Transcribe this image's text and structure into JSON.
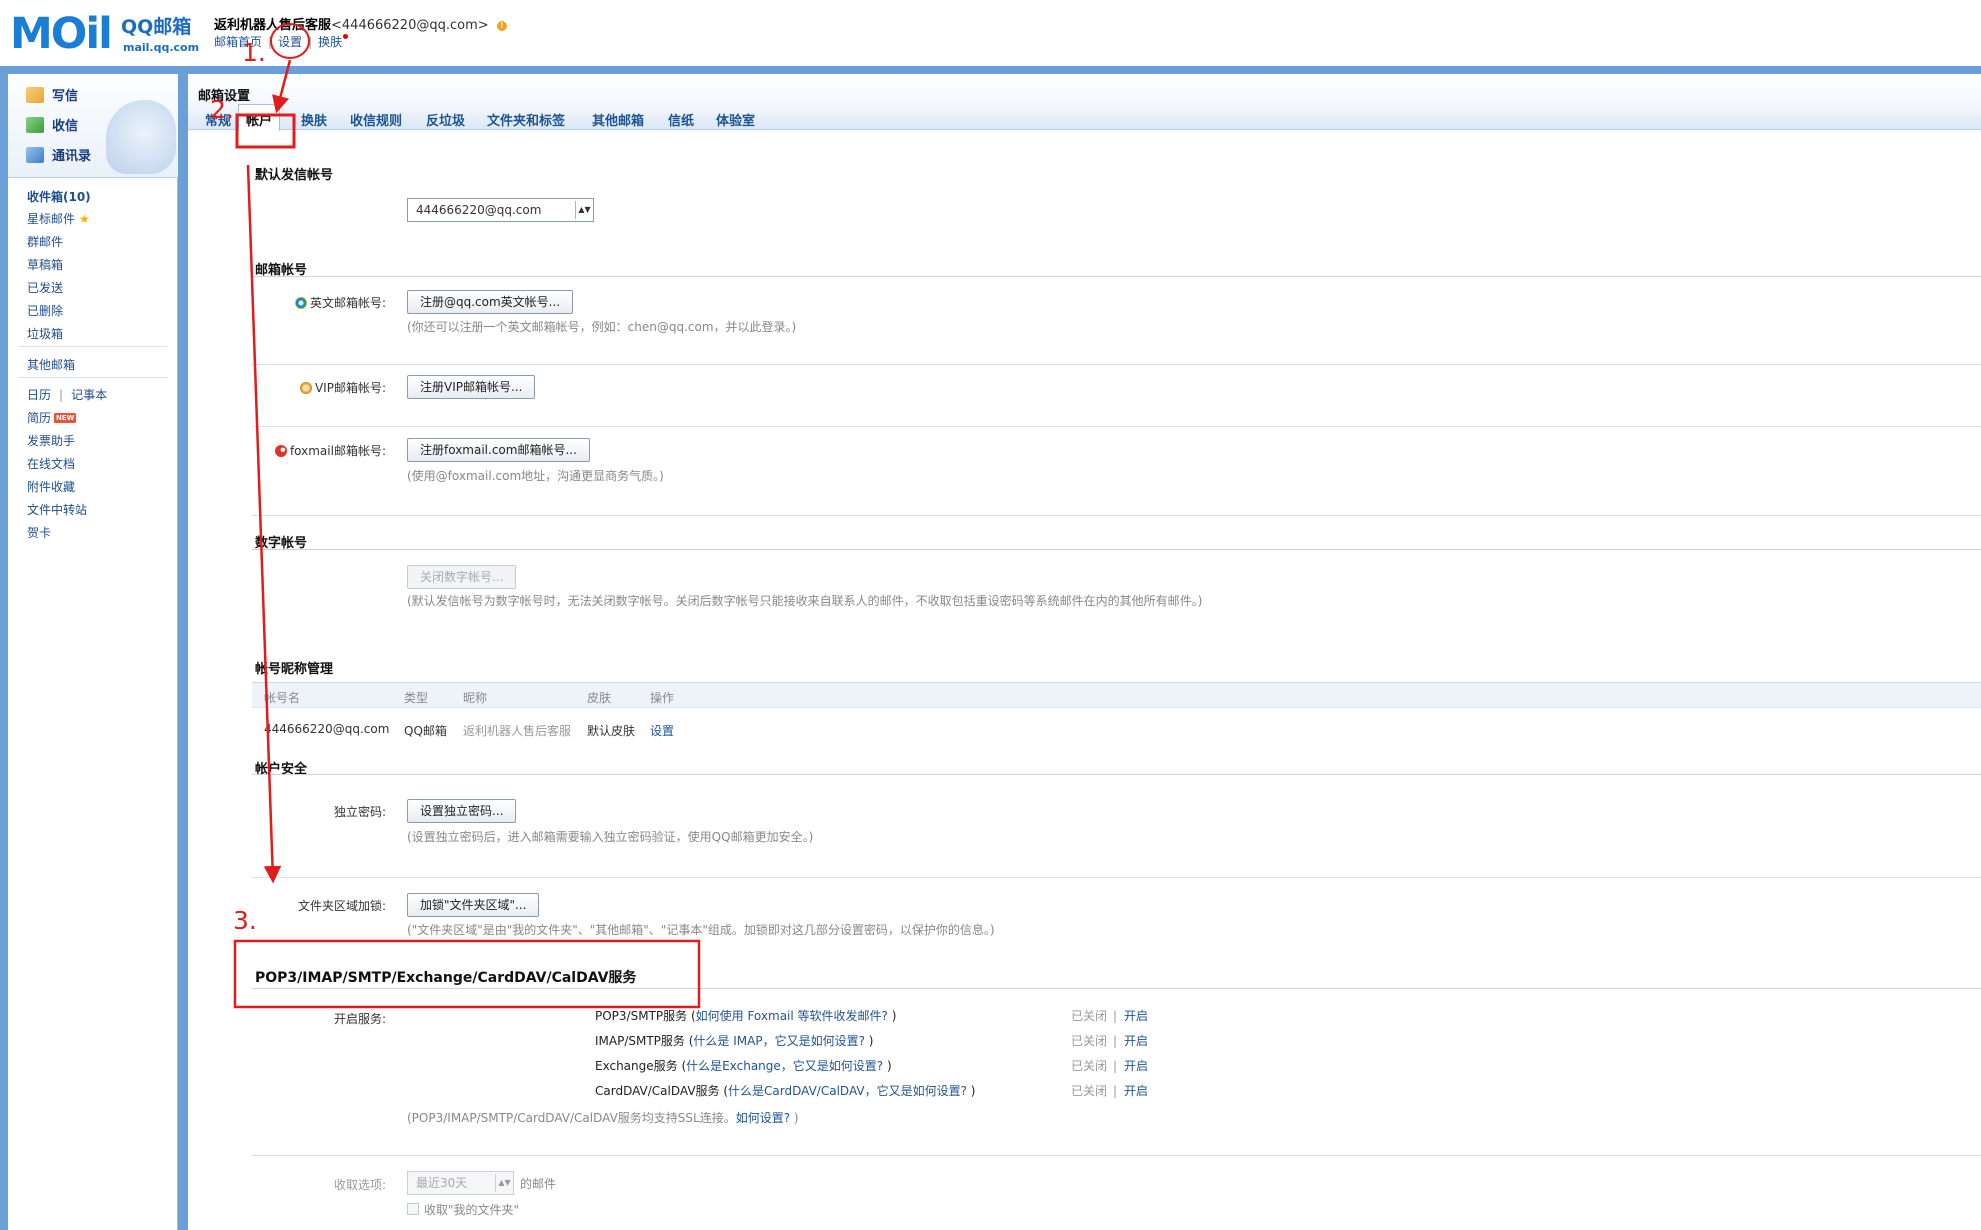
{
  "header": {
    "logo_mail": "MOil",
    "logo_qq": "QQ邮箱",
    "logo_url": "mail.qq.com",
    "user_name": "返利机器人售后客服",
    "user_email": "<444666220@qq.com>",
    "warn_icon": "!",
    "links": [
      "邮箱首页",
      "设置",
      "换肤"
    ],
    "link_sep": "|"
  },
  "sidebar": {
    "actions": [
      {
        "label": "写信",
        "icon": "compose-icon",
        "color": "#e9a23b"
      },
      {
        "label": "收信",
        "icon": "inbox-icon",
        "color": "#3a9d3a"
      },
      {
        "label": "通讯录",
        "icon": "contacts-icon",
        "color": "#3b7dc4"
      }
    ],
    "folders": [
      {
        "label": "收件箱(10)",
        "bold": true
      },
      {
        "label": "星标邮件",
        "star": "★"
      },
      {
        "label": "群邮件"
      },
      {
        "label": "草稿箱"
      },
      {
        "label": "已发送"
      },
      {
        "label": "已删除"
      },
      {
        "label": "垃圾箱"
      }
    ],
    "other_mail": "其他邮箱",
    "tools": {
      "calendar": "日历",
      "sep": "|",
      "notebook": "记事本",
      "resume": "简历",
      "new_badge": "NEW",
      "invoice": "发票助手",
      "docs": "在线文档",
      "attachments": "附件收藏",
      "transfer": "文件中转站",
      "cards": "贺卡"
    }
  },
  "main": {
    "title": "邮箱设置",
    "tabs": [
      "常规",
      "帐户",
      "换肤",
      "收信规则",
      "反垃圾",
      "文件夹和标签",
      "其他邮箱",
      "信纸",
      "体验室"
    ],
    "active_tab": 1,
    "default_sender": {
      "title": "默认发信帐号",
      "value": "444666220@qq.com",
      "arrow": "▲▼"
    },
    "mail_accounts": {
      "title": "邮箱帐号",
      "english_label": "英文邮箱帐号:",
      "english_button": "注册@qq.com英文帐号...",
      "english_hint": "(你还可以注册一个英文邮箱帐号，例如：chen@qq.com，并以此登录。)",
      "vip_label": "VIP邮箱帐号:",
      "vip_button": "注册VIP邮箱帐号...",
      "foxmail_label": "foxmail邮箱帐号:",
      "foxmail_button": "注册foxmail.com邮箱帐号...",
      "foxmail_hint": "(使用@foxmail.com地址，沟通更显商务气质。)"
    },
    "digital": {
      "title": "数字帐号",
      "button": "关闭数字帐号...",
      "hint": "(默认发信帐号为数字帐号时，无法关闭数字帐号。关闭后数字帐号只能接收来自联系人的邮件，不收取包括重设密码等系统邮件在内的其他所有邮件。)"
    },
    "nickname": {
      "title": "帐号昵称管理",
      "headers": [
        "帐号名",
        "类型",
        "昵称",
        "皮肤",
        "操作"
      ],
      "row": [
        "444666220@qq.com",
        "QQ邮箱",
        "返利机器人售后客服",
        "默认皮肤",
        "设置"
      ]
    },
    "security": {
      "title": "帐户安全",
      "pwd_label": "独立密码:",
      "pwd_button": "设置独立密码...",
      "pwd_hint": "(设置独立密码后，进入邮箱需要输入独立密码验证，使用QQ邮箱更加安全。)",
      "lock_label": "文件夹区域加锁:",
      "lock_button": "加锁\"文件夹区域\"...",
      "lock_hint": "(\"文件夹区域\"是由\"我的文件夹\"、\"其他邮箱\"、\"记事本\"组成。加锁即对这几部分设置密码，以保护你的信息。)"
    },
    "services": {
      "title": "POP3/IMAP/SMTP/Exchange/CardDAV/CalDAV服务",
      "label": "开启服务:",
      "state": "已关闭",
      "sep": "|",
      "open": "开启",
      "items": [
        {
          "name": "POP3/SMTP服务",
          "pre": " (",
          "link": "如何使用 Foxmail 等软件收发邮件?",
          "post": " )"
        },
        {
          "name": "IMAP/SMTP服务",
          "pre": " (",
          "link": "什么是 IMAP，它又是如何设置?",
          "post": " )"
        },
        {
          "name": "Exchange服务",
          "pre": " (",
          "link": "什么是Exchange，它又是如何设置?",
          "post": " )"
        },
        {
          "name": "CardDAV/CalDAV服务",
          "pre": " (",
          "link": "什么是CardDAV/CalDAV，它又是如何设置?",
          "post": " )"
        }
      ],
      "ssl_pre": "(POP3/IMAP/SMTP/CardDAV/CalDAV服务均支持SSL连接。",
      "ssl_link": "如何设置?",
      "ssl_post": " )",
      "fetch_label": "收取选项:",
      "fetch_value": "最近30天",
      "fetch_suffix": "的邮件",
      "fetch_check": "收取\"我的文件夹\""
    }
  },
  "annotations": {
    "step1": "1.",
    "step2": "2.",
    "step3": "3.",
    "color": "#e21b1b"
  }
}
